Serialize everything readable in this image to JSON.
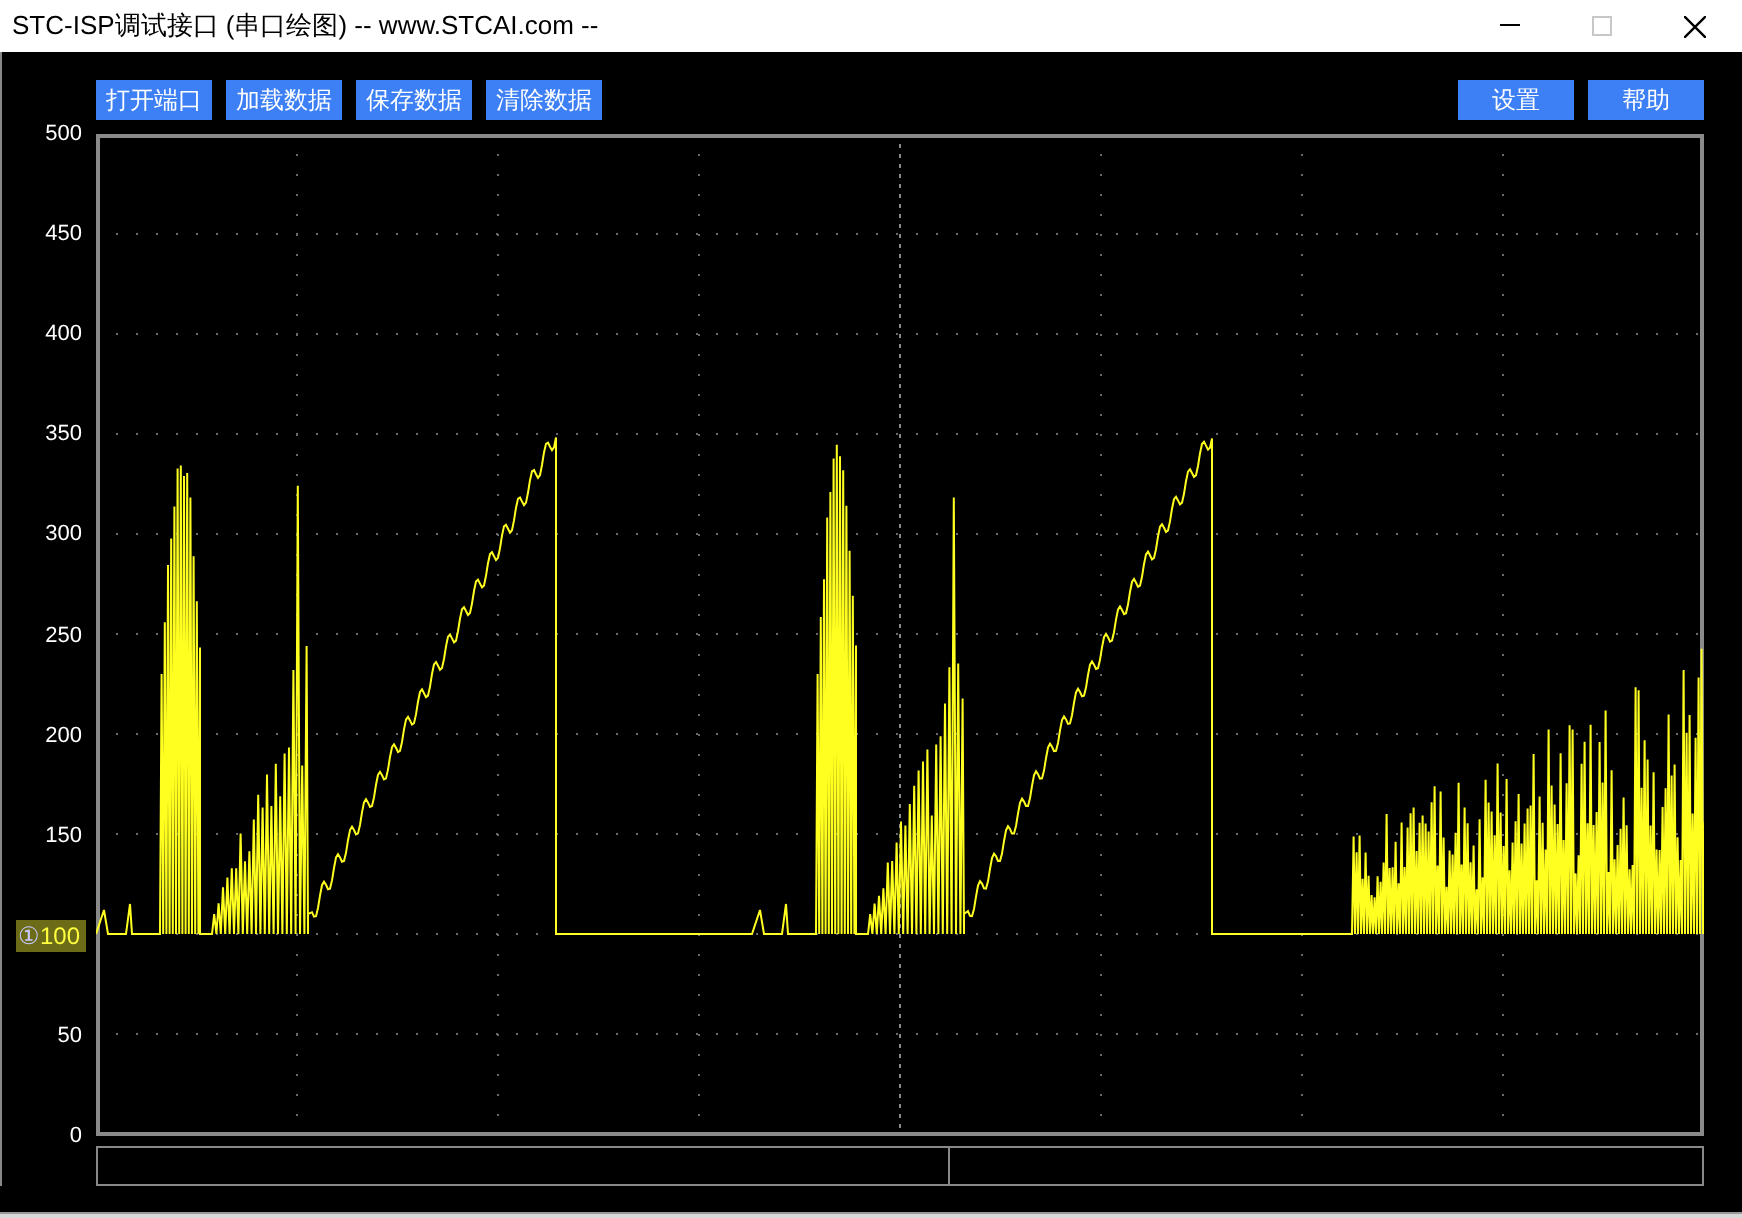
{
  "window": {
    "title": "STC-ISP调试接口 (串口绘图) -- www.STCAI.com --",
    "maximize_disabled": true
  },
  "toolbar_left": [
    "打开端口",
    "加载数据",
    "保存数据",
    "清除数据"
  ],
  "toolbar_right": [
    "设置",
    "帮助"
  ],
  "plot": {
    "y_labels": [
      {
        "text": "500"
      },
      {
        "text": "450"
      },
      {
        "text": "400"
      },
      {
        "text": "350"
      },
      {
        "text": "300"
      },
      {
        "text": "250"
      },
      {
        "text": "200"
      },
      {
        "text": "150"
      },
      {
        "text": "100",
        "marker": "①"
      },
      {
        "text": "50"
      },
      {
        "text": "0"
      }
    ]
  }
}
